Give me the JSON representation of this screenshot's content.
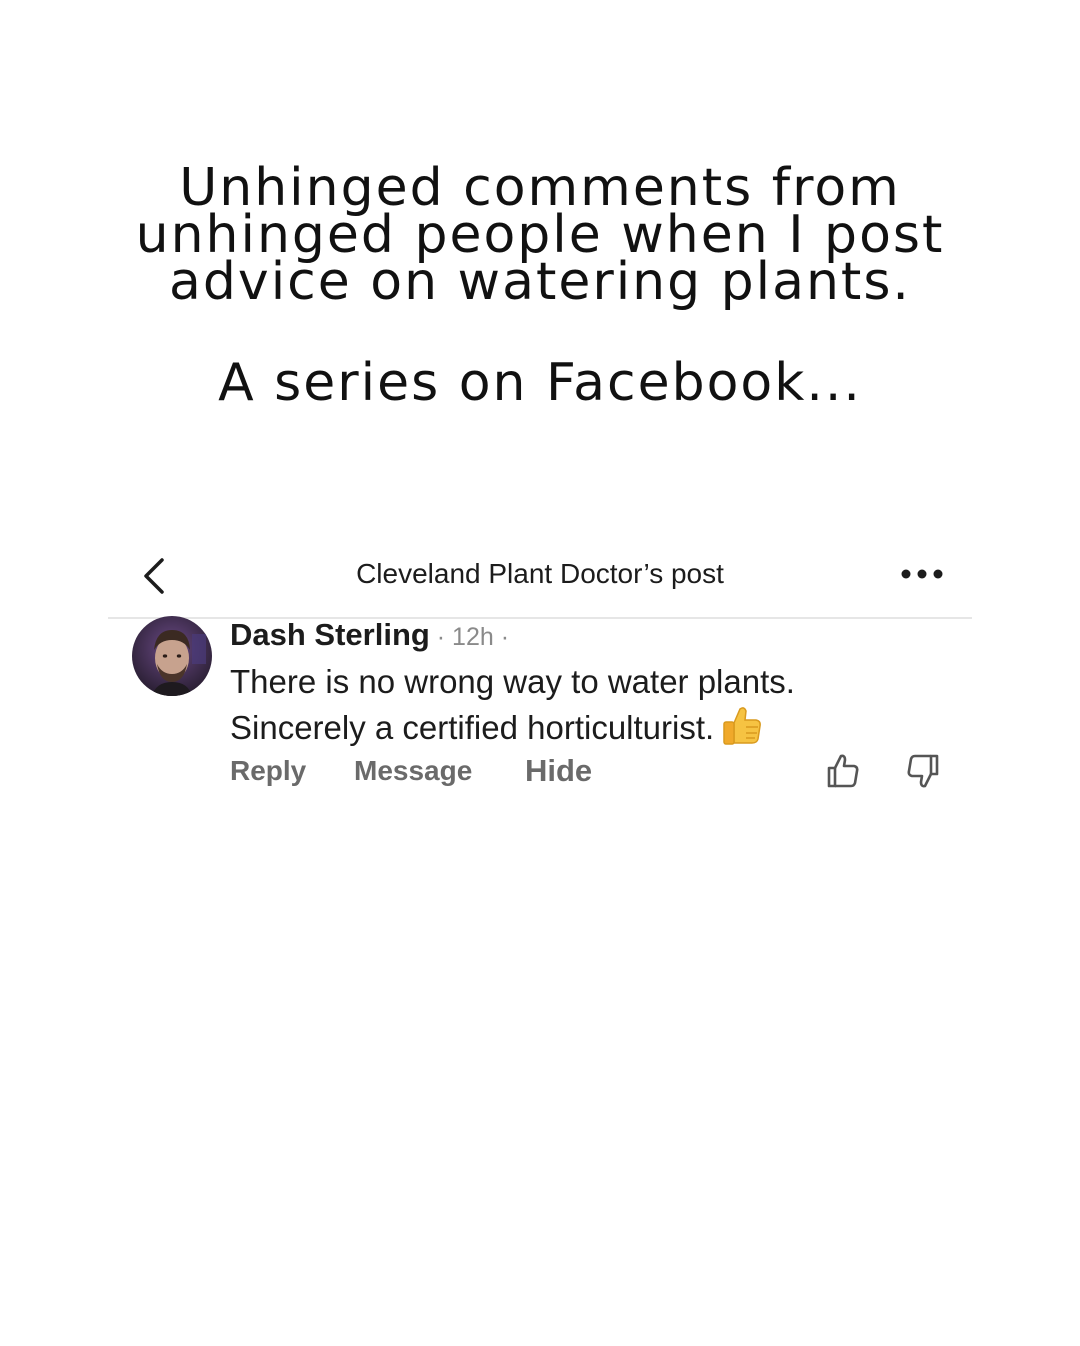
{
  "headline": {
    "lines": [
      "Unhinged comments from",
      "unhinged people when I post",
      "advice on watering plants."
    ],
    "subtitle": "A series on Facebook..."
  },
  "facebook": {
    "header": {
      "back_icon": "chevron-left-icon",
      "title": "Cleveland Plant Doctor’s post",
      "more_icon": "more-dots-icon"
    },
    "comment": {
      "author": "Dash Sterling",
      "meta_separator": " · ",
      "time": "12h",
      "meta_trailing": " ·",
      "text_lines": [
        "There is no wrong way to water plants.",
        "Sincerely a certified horticulturist."
      ],
      "emoji_icon": "thumbs-up-emoji-icon",
      "actions": {
        "reply": "Reply",
        "message": "Message",
        "hide": "Hide"
      },
      "upvote_icon": "upvote-icon",
      "downvote_icon": "downvote-icon"
    }
  }
}
